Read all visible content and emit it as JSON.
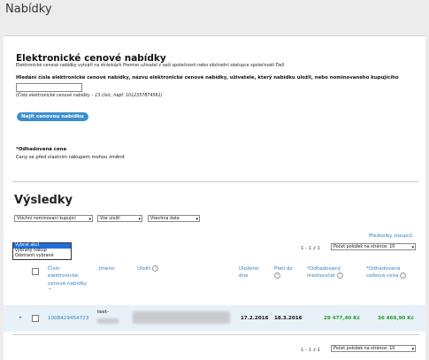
{
  "page_title": "Nabídky",
  "header": {
    "title": "Elektronické cenové nabídky",
    "subtitle": "Elektronické cenové nabídky vytváří na stránkách Premier uživatel z vaší společnosti nebo obchodní zástupce společnosti Dell"
  },
  "search": {
    "label": "Hledání čísla elektronické cenové nabídky, názvu elektronické cenové nabídky, uživatele, který nabídku uložil, nebo nominovaného kupujícího",
    "value": "",
    "hint": "(Číslo elektronické cenové nabídky – 13 čísic, např. 1012357874561)",
    "button_label": "Najít cenovou nabídku"
  },
  "estimate": {
    "label": "*Odhadovaná cena",
    "text": "Ceny se před vlastním nákupem mohou změnit"
  },
  "results": {
    "title": "Výsledky",
    "filters": [
      {
        "value": "Všichni nominovaní kupující"
      },
      {
        "value": "Vše uložil"
      },
      {
        "value": "Všechna data"
      }
    ],
    "dropdown_options": [
      "Vybrat akci",
      "vybraný nákup",
      "Odstranit vybrané"
    ],
    "columns_link": "Předvolby sloupců",
    "pagination": "1 - 1 z 1",
    "per_page": "Počet položek na stránce: 10",
    "columns": {
      "number": "Číslo elektronické cenové nabídky",
      "name": "Jméno",
      "saved_by": "Uložil",
      "saved_date": "Uloženo dne",
      "valid_until": "Platí do",
      "subtotal": "*Odhadovaný mezisoučet",
      "total": "*Odhadovaná celková cena"
    },
    "rows": [
      {
        "number": "1008429454723",
        "name": "test-",
        "saved_date": "17.2.2016",
        "valid_until": "18.3.2016",
        "subtotal": "29 477,40 Kč",
        "total": "36 469,90 Kč"
      }
    ]
  },
  "colors": {
    "accent": "#2d7fc4",
    "button": "#3d8fd0",
    "green": "#229a35",
    "row_highlight": "#e8f0f8"
  }
}
